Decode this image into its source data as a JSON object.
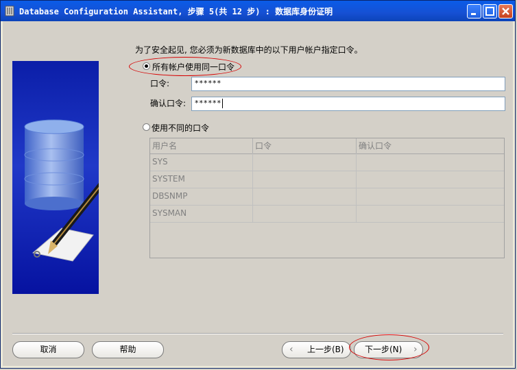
{
  "window": {
    "title": "Database Configuration Assistant, 步骤 5(共 12 步) : 数据库身份证明"
  },
  "main": {
    "instruction": "为了安全起见, 您必须为新数据库中的以下用户帐户指定口令。",
    "same_password": {
      "label": "所有帐户使用同一口令",
      "selected": true,
      "password_label": "口令:",
      "password_value": "******",
      "confirm_label": "确认口令:",
      "confirm_value": "******"
    },
    "different_password": {
      "label": "使用不同的口令",
      "selected": false
    },
    "table": {
      "columns": [
        "用户名",
        "口令",
        "确认口令"
      ],
      "rows": [
        [
          "SYS",
          "",
          ""
        ],
        [
          "SYSTEM",
          "",
          ""
        ],
        [
          "DBSNMP",
          "",
          ""
        ],
        [
          "SYSMAN",
          "",
          ""
        ]
      ]
    }
  },
  "footer": {
    "cancel": "取消",
    "help": "帮助",
    "back": "上一步(B)",
    "next": "下一步(N)"
  },
  "colors": {
    "title_bar": "#0a5ce8",
    "highlight_ellipse": "#d60000",
    "side_panel": "#1428b8"
  }
}
